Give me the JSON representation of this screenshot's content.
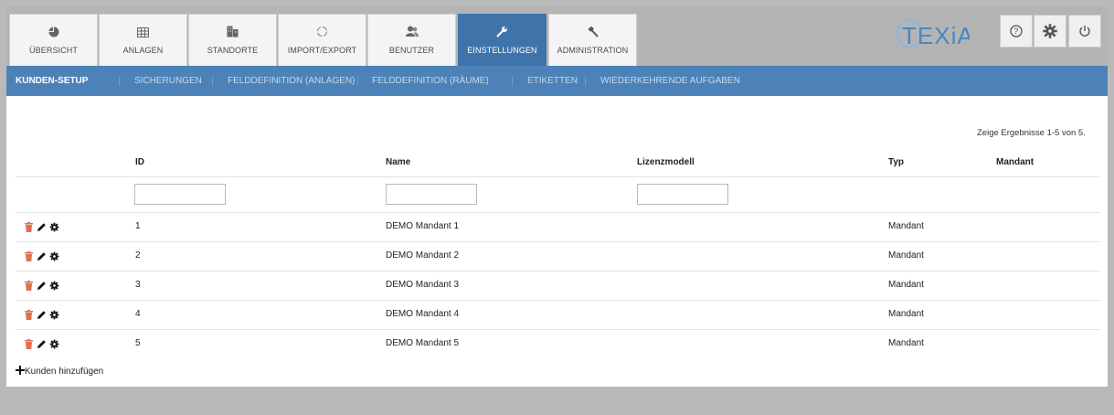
{
  "tabs": [
    {
      "label": "ÜBERSICHT",
      "icon": "pie-chart-icon"
    },
    {
      "label": "ANLAGEN",
      "icon": "table-icon"
    },
    {
      "label": "STANDORTE",
      "icon": "building-icon"
    },
    {
      "label": "IMPORT/EXPORT",
      "icon": "refresh-circle-icon"
    },
    {
      "label": "BENUTZER",
      "icon": "users-icon"
    },
    {
      "label": "EINSTELLUNGEN",
      "icon": "wrench-icon",
      "active": true
    },
    {
      "label": "ADMINISTRATION",
      "icon": "hammer-icon"
    }
  ],
  "logo": {
    "text": "TEXiA"
  },
  "top_icons": [
    "help-icon",
    "gear-icon",
    "power-icon"
  ],
  "subnav": [
    {
      "label": "KUNDEN-SETUP",
      "active": true
    },
    {
      "label": "SICHERUNGEN"
    },
    {
      "label": "FELDDEFINITION (ANLAGEN)"
    },
    {
      "label": "FELDDEFINITION (RÄUME)"
    },
    {
      "label": "ETIKETTEN"
    },
    {
      "label": "WIEDERKEHRENDE AUFGABEN"
    }
  ],
  "results_text": "Zeige Ergebnisse 1-5 von 5.",
  "columns": [
    "ID",
    "Name",
    "Lizenzmodell",
    "Typ",
    "Mandant"
  ],
  "filters": {
    "id": "",
    "name": "",
    "lizenzmodell": ""
  },
  "rows": [
    {
      "id": "1",
      "name": "DEMO Mandant 1",
      "lizenzmodell": "",
      "typ": "Mandant",
      "mandant": ""
    },
    {
      "id": "2",
      "name": "DEMO Mandant 2",
      "lizenzmodell": "",
      "typ": "Mandant",
      "mandant": ""
    },
    {
      "id": "3",
      "name": "DEMO Mandant 3",
      "lizenzmodell": "",
      "typ": "Mandant",
      "mandant": ""
    },
    {
      "id": "4",
      "name": "DEMO Mandant 4",
      "lizenzmodell": "",
      "typ": "Mandant",
      "mandant": ""
    },
    {
      "id": "5",
      "name": "DEMO Mandant 5",
      "lizenzmodell": "",
      "typ": "Mandant",
      "mandant": ""
    }
  ],
  "row_actions": [
    "trash-icon",
    "pencil-icon",
    "gear-icon"
  ],
  "add_label": "Kunden hinzufügen",
  "colors": {
    "accent": "#3f74ab",
    "subnav": "#4c82b8",
    "trash": "#e07050",
    "logo": "#4a86c4"
  }
}
